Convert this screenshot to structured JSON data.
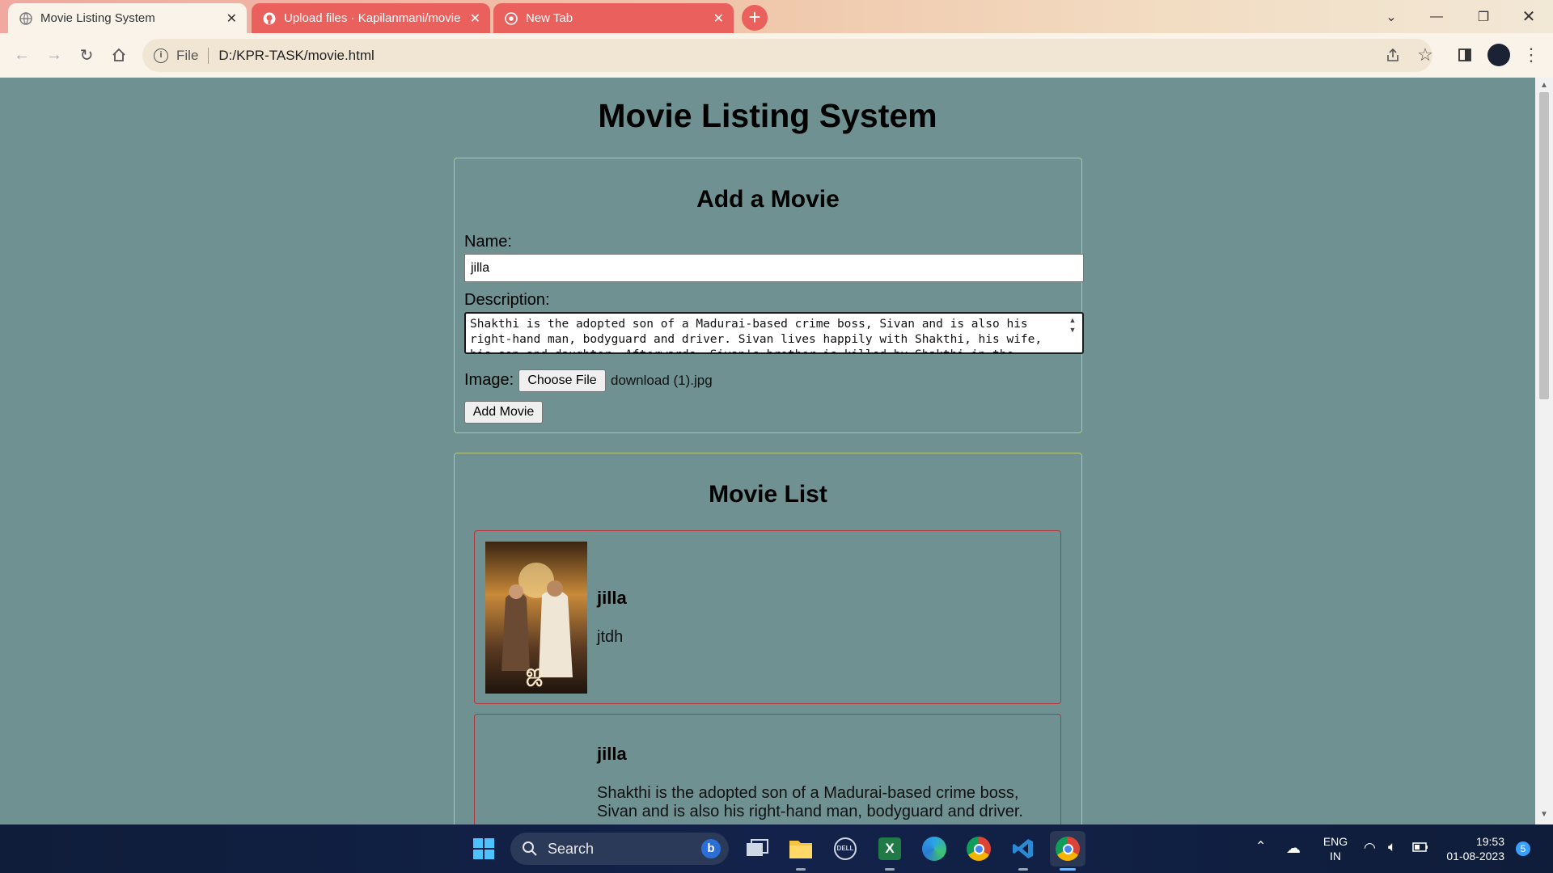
{
  "browser": {
    "tabs": [
      {
        "title": "Movie Listing System",
        "active": true
      },
      {
        "title": "Upload files · Kapilanmani/movie",
        "active": false
      },
      {
        "title": "New Tab",
        "active": false
      }
    ],
    "new_tab_label": "+",
    "address": {
      "scheme_label": "File",
      "url": "D:/KPR-TASK/movie.html"
    }
  },
  "page": {
    "title": "Movie Listing System",
    "form": {
      "heading": "Add a Movie",
      "name_label": "Name:",
      "name_value": "jilla",
      "description_label": "Description:",
      "description_value": "Shakthi is the adopted son of a Madurai-based crime boss, Sivan and is also his right-hand man, bodyguard and driver. Sivan lives happily with Shakthi, his wife, his son and daughter. Afterwards, Sivan's brother is killed by Shakthi in the police",
      "image_label": "Image:",
      "choose_file_label": "Choose File",
      "file_name": "download (1).jpg",
      "submit_label": "Add Movie"
    },
    "list": {
      "heading": "Movie List",
      "movies": [
        {
          "name": "jilla",
          "description": "jtdh",
          "has_poster": true
        },
        {
          "name": "jilla",
          "description": "Shakthi is the adopted son of a Madurai-based crime boss, Sivan and is also his right-hand man, bodyguard and driver.",
          "has_poster": false
        }
      ]
    }
  },
  "taskbar": {
    "search_label": "Search",
    "language": "ENG",
    "region": "IN",
    "time": "19:53",
    "date": "01-08-2023",
    "notification_count": "5"
  },
  "colors": {
    "page_background": "#6f9191",
    "panel_border": "#b5c97f",
    "card_border": "#b0373c",
    "active_tab": "#faf3ea",
    "inactive_tab": "#e9605d"
  }
}
